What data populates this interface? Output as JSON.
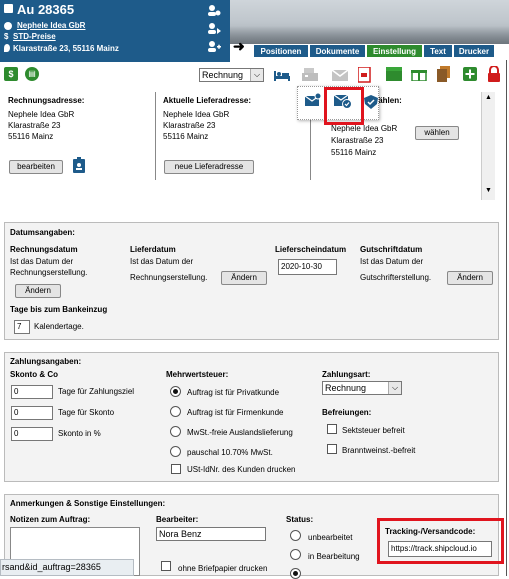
{
  "header": {
    "order_title": "Au 28365",
    "customer_name": "Nephele Idea GbR",
    "price_list": "STD-Preise",
    "address": "Klarastraße 23, 55116 Mainz"
  },
  "tabs": [
    "Positionen",
    "Dokumente",
    "Einstellung",
    "Text",
    "Drucker"
  ],
  "active_tab": "Einstellung",
  "toolbar": {
    "doc_type_select": "Rechnung",
    "popup_hint": "wählen:"
  },
  "addresses": {
    "billing_heading": "Rechnungsadresse:",
    "billing_lines": [
      "Nephele Idea GbR",
      "Klarastraße 23",
      "55116 Mainz"
    ],
    "edit_button": "bearbeiten",
    "delivery_heading": "Aktuelle Lieferadresse:",
    "delivery_lines": [
      "Nephele Idea GbR",
      "Klarastraße 23",
      "55116 Mainz"
    ],
    "new_delivery_button": "neue Lieferadresse",
    "other_lines": [
      "Nephele Idea GbR",
      "Klarastraße 23",
      "55116 Mainz"
    ],
    "choose_button": "wählen"
  },
  "dates": {
    "section_title": "Datumsangaben:",
    "invoice_label": "Rechnungsdatum",
    "invoice_desc1": "Ist das Datum der",
    "invoice_desc2": "Rechnungserstellung.",
    "change_button": "Ändern",
    "delivery_label": "Lieferdatum",
    "delivery_desc1": "Ist das Datum der",
    "delivery_desc2": "Rechnungserstellung.",
    "delivery_note_label": "Lieferscheindatum",
    "delivery_note_value": "2020-10-30",
    "credit_label": "Gutschriftdatum",
    "credit_desc1": "Ist das Datum der",
    "credit_desc2": "Gutschrifterstellung.",
    "bank_days_label": "Tage bis zum Bankeinzug",
    "bank_days_value": "7",
    "bank_days_unit": "Kalendertage."
  },
  "payment": {
    "section_title": "Zahlungsangaben:",
    "discount_title": "Skonto & Co",
    "payment_days_value": "0",
    "payment_days_label": "Tage für Zahlungsziel",
    "discount_days_value": "0",
    "discount_days_label": "Tage für Skonto",
    "discount_pct_value": "0",
    "discount_pct_label": "Skonto in %",
    "vat_title": "Mehrwertsteuer:",
    "vat_options": [
      "Auftrag ist für Privatkunde",
      "Auftrag ist für Firmenkunde",
      "MwSt.-freie Auslandslieferung",
      "pauschal 10.70% MwSt."
    ],
    "vat_selected_index": 0,
    "print_vatid_label": "USt-IdNr. des Kunden drucken",
    "payment_type_title": "Zahlungsart:",
    "payment_type_value": "Rechnung",
    "exemptions_title": "Befreiungen:",
    "exemption_options": [
      "Sektsteuer befreit",
      "Branntweinst.-befreit"
    ]
  },
  "notes": {
    "section_title": "Anmerkungen & Sonstige Einstellungen:",
    "order_notes_label": "Notizen zum Auftrag:",
    "editor_label": "Bearbeiter:",
    "editor_value": "Nora Benz",
    "no_letterhead_label": "ohne Briefpapier drucken",
    "status_title": "Status:",
    "status_options": [
      "unbearbeitet",
      "in Bearbeitung"
    ],
    "tracking_label": "Tracking-/Versandcode:",
    "tracking_value": "https://track.shipcloud.io"
  },
  "status_url": "rsand&id_auftrag=28365",
  "colors": {
    "header_blue": "#1e5b8a",
    "active_tab_green": "#2e8b2e",
    "highlight_red": "#e0141e",
    "panel_bg": "#f3f3f3"
  }
}
